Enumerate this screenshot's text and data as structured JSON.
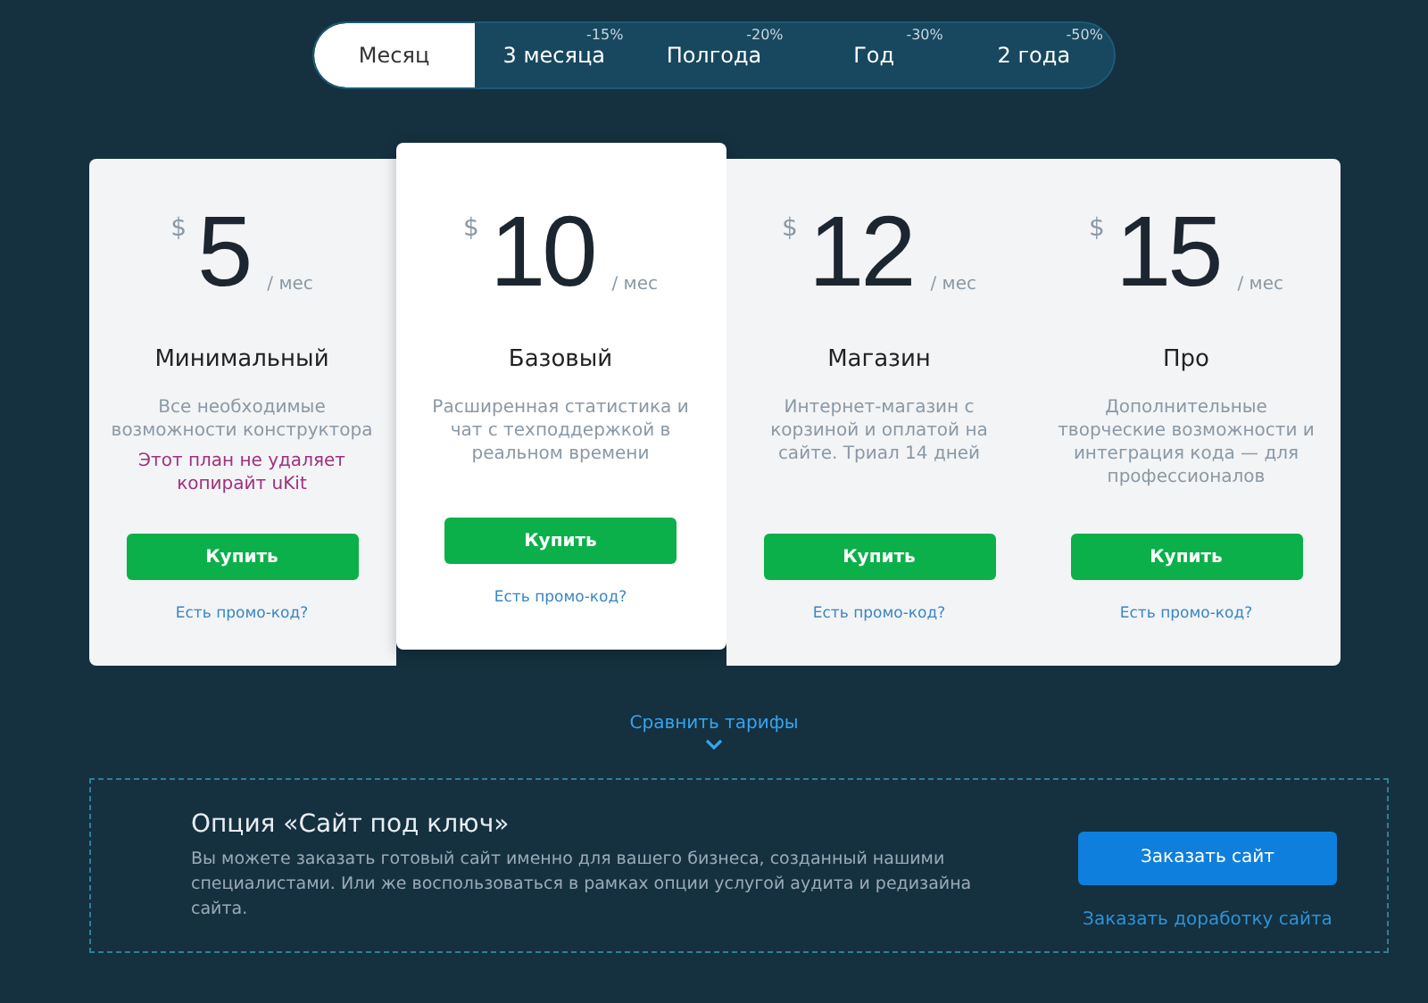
{
  "periods": [
    {
      "label": "Месяц",
      "selected": true
    },
    {
      "label": "3 месяца",
      "discount": "-15%",
      "selected": false
    },
    {
      "label": "Полгода",
      "discount": "-20%",
      "selected": false
    },
    {
      "label": "Год",
      "discount": "-30%",
      "selected": false
    },
    {
      "label": "2 года",
      "discount": "-50%",
      "selected": false
    }
  ],
  "plans": [
    {
      "currency": "$",
      "price": "5",
      "unit": "/ мес",
      "name": "Минимальный",
      "description": "Все необходимые возможности конструктора",
      "note": "Этот план не удаляет копирайт uKit",
      "button": "Купить",
      "promo": "Есть промо-код?",
      "highlighted": false
    },
    {
      "currency": "$",
      "price": "10",
      "unit": "/ мес",
      "name": "Базовый",
      "description": "Расширенная статистика и чат с техподдержкой в реальном времени",
      "button": "Купить",
      "promo": "Есть промо-код?",
      "highlighted": true
    },
    {
      "currency": "$",
      "price": "12",
      "unit": "/ мес",
      "name": "Магазин",
      "description": "Интернет-магазин с корзиной и оплатой на сайте. Триал 14 дней",
      "button": "Купить",
      "promo": "Есть промо-код?",
      "highlighted": false
    },
    {
      "currency": "$",
      "price": "15",
      "unit": "/ мес",
      "name": "Про",
      "description": "Дополнительные творческие возможности и интеграция кода — для профессионалов",
      "button": "Купить",
      "promo": "Есть промо-код?",
      "highlighted": false
    }
  ],
  "compare_link": "Сравнить тарифы",
  "turnkey": {
    "title": "Опция «Сайт под ключ»",
    "text": "Вы можете заказать готовый сайт именно для вашего бизнеса, созданный нашими специалистами. Или же воспользоваться в рамках опции услугой аудита и редизайна сайта.",
    "button": "Заказать сайт",
    "link": "Заказать доработку сайта"
  }
}
